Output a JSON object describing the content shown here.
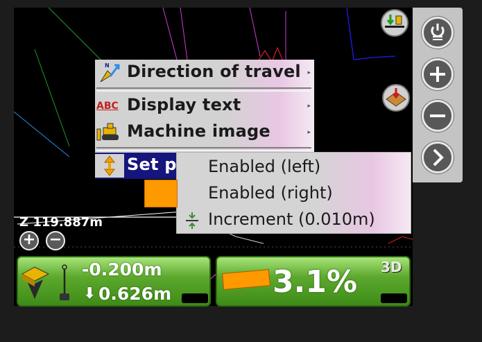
{
  "menu": {
    "direction_of_travel": "Direction of travel",
    "abc_icon_text": "ABC",
    "display_text": "Display text",
    "machine_image": "Machine image",
    "set_p": "Set p",
    "submenu_arrow": "▸"
  },
  "submenu": {
    "enabled_left": "Enabled (left)",
    "enabled_right": "Enabled (right)",
    "increment": "Increment (0.010m)"
  },
  "map": {
    "z_value": "Z 119.887m",
    "zoom_in": "+",
    "zoom_out": "−"
  },
  "panels": {
    "left": {
      "top_value": "-0.200m",
      "bottom_value": "0.626m",
      "down_arrow": "⬇"
    },
    "right": {
      "grade_value": "3.1%",
      "mode_badge": "3D"
    }
  },
  "side_panel": {
    "buttons": [
      "power-menu-icon",
      "plus-icon",
      "minus-icon",
      "chevron-right-icon"
    ]
  },
  "colors": {
    "menu_highlight": "#15157e",
    "panel_green": "#4a9a22",
    "orange_marker": "#ff9900"
  }
}
